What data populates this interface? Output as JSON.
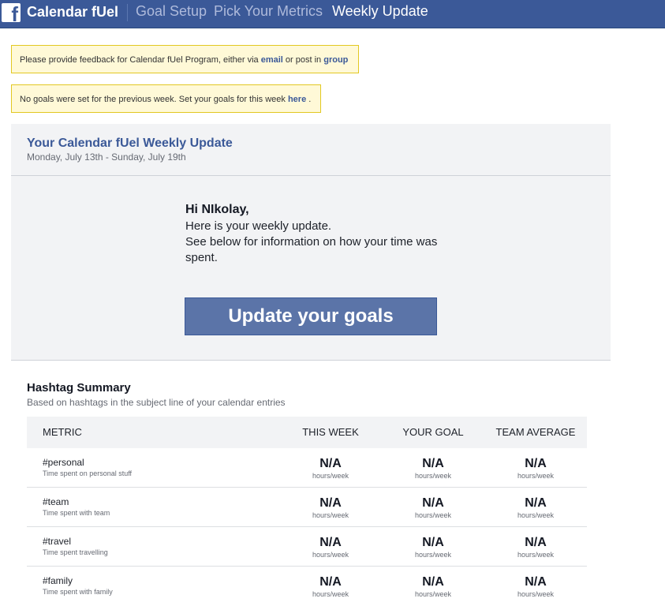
{
  "nav": {
    "logo_icon": "facebook-f-icon",
    "logo_glyph": "f",
    "app_title": "Calendar fUel",
    "links": [
      "Goal Setup",
      "Pick Your Metrics",
      "Weekly Update"
    ],
    "active": "Weekly Update"
  },
  "notices": {
    "feedback": {
      "prefix": "Please provide feedback for Calendar fUel Program, either via ",
      "email_link": "email",
      "middle": " or post in ",
      "group_link": "group"
    },
    "goals": {
      "prefix": "No goals were set for the previous week. Set your goals for this week ",
      "here_link": "here",
      "suffix": " ."
    }
  },
  "update": {
    "title": "Your Calendar fUel Weekly Update",
    "date_range": "Monday, July 13th - Sunday, July 19th",
    "greeting": "Hi NIkolay,",
    "line1": "Here is your weekly update.",
    "line2": "See below for information on how your time was spent.",
    "button": "Update your goals"
  },
  "summary": {
    "title": "Hashtag Summary",
    "subtitle": "Based on hashtags in the subject line of your calendar entries",
    "columns": [
      "METRIC",
      "THIS WEEK",
      "YOUR GOAL",
      "TEAM AVERAGE"
    ],
    "rows": [
      {
        "tag": "#personal",
        "desc": "Time spent on personal stuff",
        "this_week": "N/A",
        "goal": "N/A",
        "team": "N/A",
        "unit": "hours/week"
      },
      {
        "tag": "#team",
        "desc": "Time spent with team",
        "this_week": "N/A",
        "goal": "N/A",
        "team": "N/A",
        "unit": "hours/week"
      },
      {
        "tag": "#travel",
        "desc": "Time spent travelling",
        "this_week": "N/A",
        "goal": "N/A",
        "team": "N/A",
        "unit": "hours/week"
      },
      {
        "tag": "#family",
        "desc": "Time spent with family",
        "this_week": "N/A",
        "goal": "N/A",
        "team": "N/A",
        "unit": "hours/week"
      }
    ]
  },
  "colors": {
    "brand": "#3b5998",
    "notice_bg": "#fff9d7",
    "notice_border": "#e2c822",
    "button": "#5b74a8"
  }
}
